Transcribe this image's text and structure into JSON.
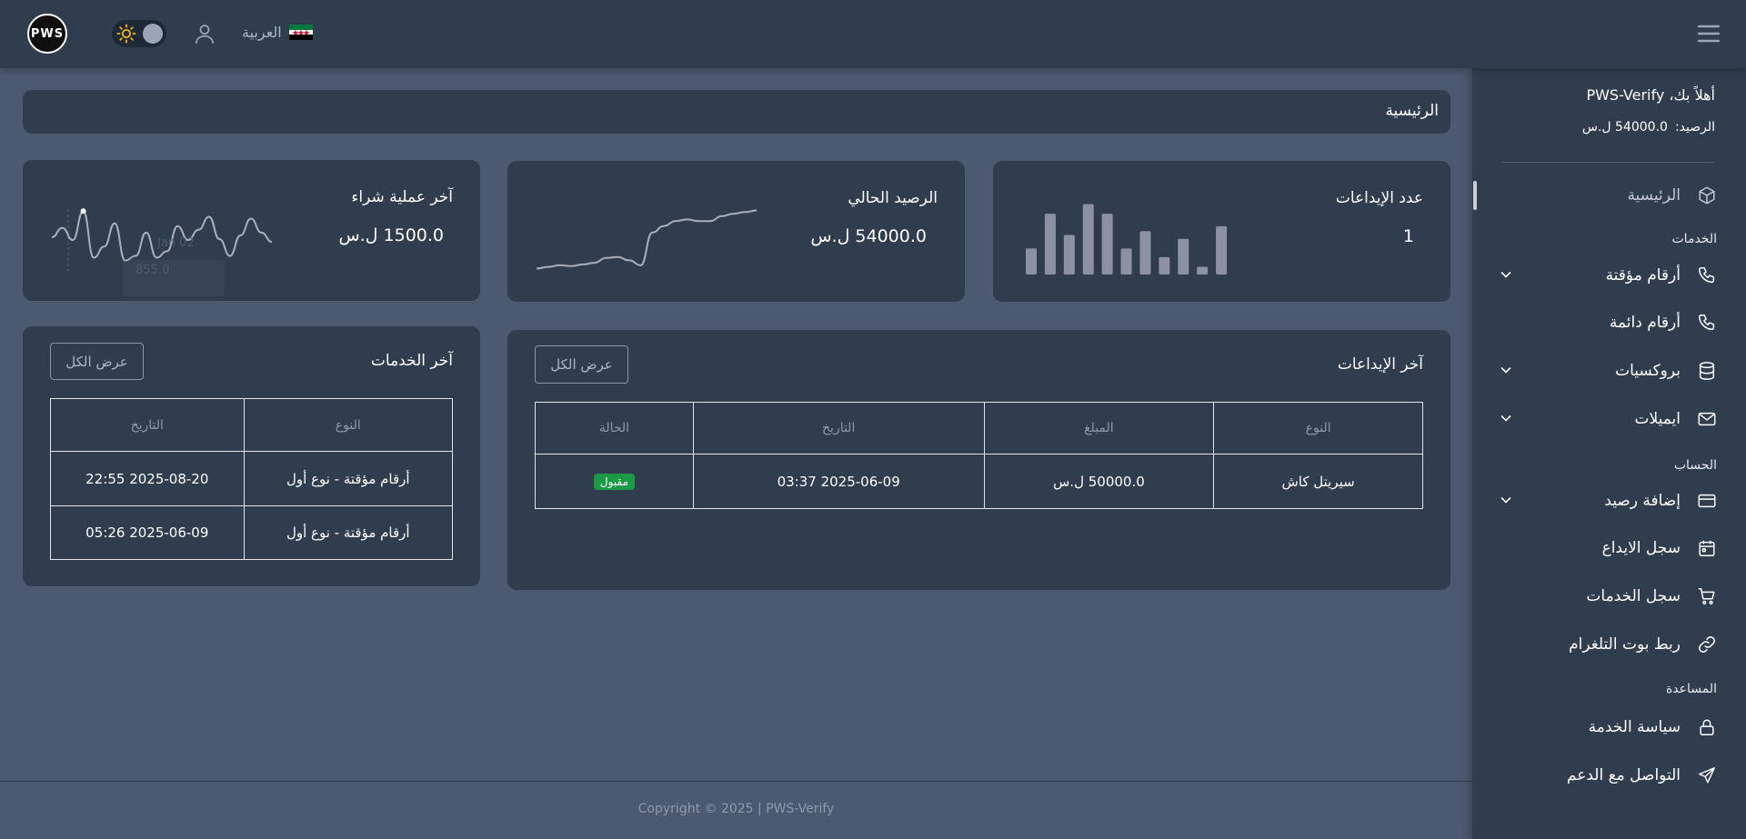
{
  "header": {
    "logo_text": "PWS",
    "language": "العربية",
    "flag_colors": [
      "#007a3d",
      "#ffffff",
      "#000000"
    ]
  },
  "sidebar": {
    "welcome": "أهلاً بك، PWS-Verify",
    "balance_label": "الرصيد:",
    "balance_value": "54000.0 ل.س",
    "home": "الرئيسية",
    "section_services": "الخدمات",
    "temp_numbers": "أرقام مؤقتة",
    "perm_numbers": "أرقام دائمة",
    "proxies": "بروكسيات",
    "emails": "ايميلات",
    "section_account": "الحساب",
    "add_balance": "إضافة رصيد",
    "deposit_log": "سجل الايداع",
    "services_log": "سجل الخدمات",
    "telegram_bot": "ربط بوت التلغرام",
    "section_help": "المساعدة",
    "service_policy": "سياسة الخدمة",
    "contact_support": "التواصل مع الدعم"
  },
  "breadcrumb": "الرئيسية",
  "cards": {
    "deposits_count": {
      "title": "عدد الإيداعات",
      "value": "1"
    },
    "current_balance": {
      "title": "الرصيد الحالي",
      "value": "54000.0 ل.س"
    },
    "last_purchase": {
      "title": "آخر عملية شراء",
      "value": "1500.0 ل.س",
      "tooltip_date": "Jan 02",
      "tooltip_value": "855.0"
    }
  },
  "deposits_table": {
    "title": "آخر الإيداعات",
    "view_all": "عرض الكل",
    "headers": [
      "النوع",
      "المبلغ",
      "التاريخ",
      "الحالة"
    ],
    "rows": [
      {
        "type": "سيريتل كاش",
        "amount": "50000.0 ل.س",
        "date": "2025-06-09 03:37",
        "status": "مقبول"
      }
    ]
  },
  "services_table": {
    "title": "آخر الخدمات",
    "view_all": "عرض الكل",
    "headers": [
      "النوع",
      "التاريخ"
    ],
    "rows": [
      {
        "type": "أرقام مؤقتة - نوع أول",
        "date": "2025-08-20 22:55"
      },
      {
        "type": "أرقام مؤقتة - نوع أول",
        "date": "2025-06-09 05:26"
      }
    ]
  },
  "chart_data": [
    {
      "type": "bar",
      "title": "",
      "categories": [
        "1",
        "2",
        "3",
        "4",
        "5",
        "6",
        "7",
        "8",
        "9",
        "10",
        "11"
      ],
      "values": [
        27,
        63,
        41,
        73,
        63,
        27,
        45,
        18,
        37,
        8,
        50
      ],
      "ylim": [
        0,
        80
      ],
      "color": "#8c92a3"
    },
    {
      "type": "line",
      "title": "",
      "x": [
        1,
        2,
        3,
        4,
        5,
        6,
        7,
        8,
        9,
        10,
        11,
        12,
        13,
        14,
        15,
        16,
        17,
        18,
        19,
        20
      ],
      "values": [
        4,
        6,
        8,
        7,
        9,
        11,
        17,
        18,
        14,
        8,
        48,
        56,
        62,
        64,
        62,
        62,
        68,
        71,
        73,
        75
      ],
      "ylim": [
        0,
        80
      ],
      "color": "#a9b0bd"
    },
    {
      "type": "line",
      "title": "",
      "x": [
        1,
        2,
        3,
        4,
        5,
        6,
        7,
        8,
        9,
        10,
        11,
        12,
        13,
        14,
        15,
        16,
        17,
        18,
        19,
        20,
        21,
        22
      ],
      "values": [
        40,
        50,
        37,
        68,
        18,
        30,
        55,
        15,
        20,
        45,
        18,
        25,
        52,
        37,
        48,
        62,
        38,
        20,
        42,
        60,
        45,
        35
      ],
      "ylim": [
        0,
        80
      ],
      "color": "#a9b0bd"
    }
  ],
  "footer": "Copyright © 2025 | PWS-Verify"
}
